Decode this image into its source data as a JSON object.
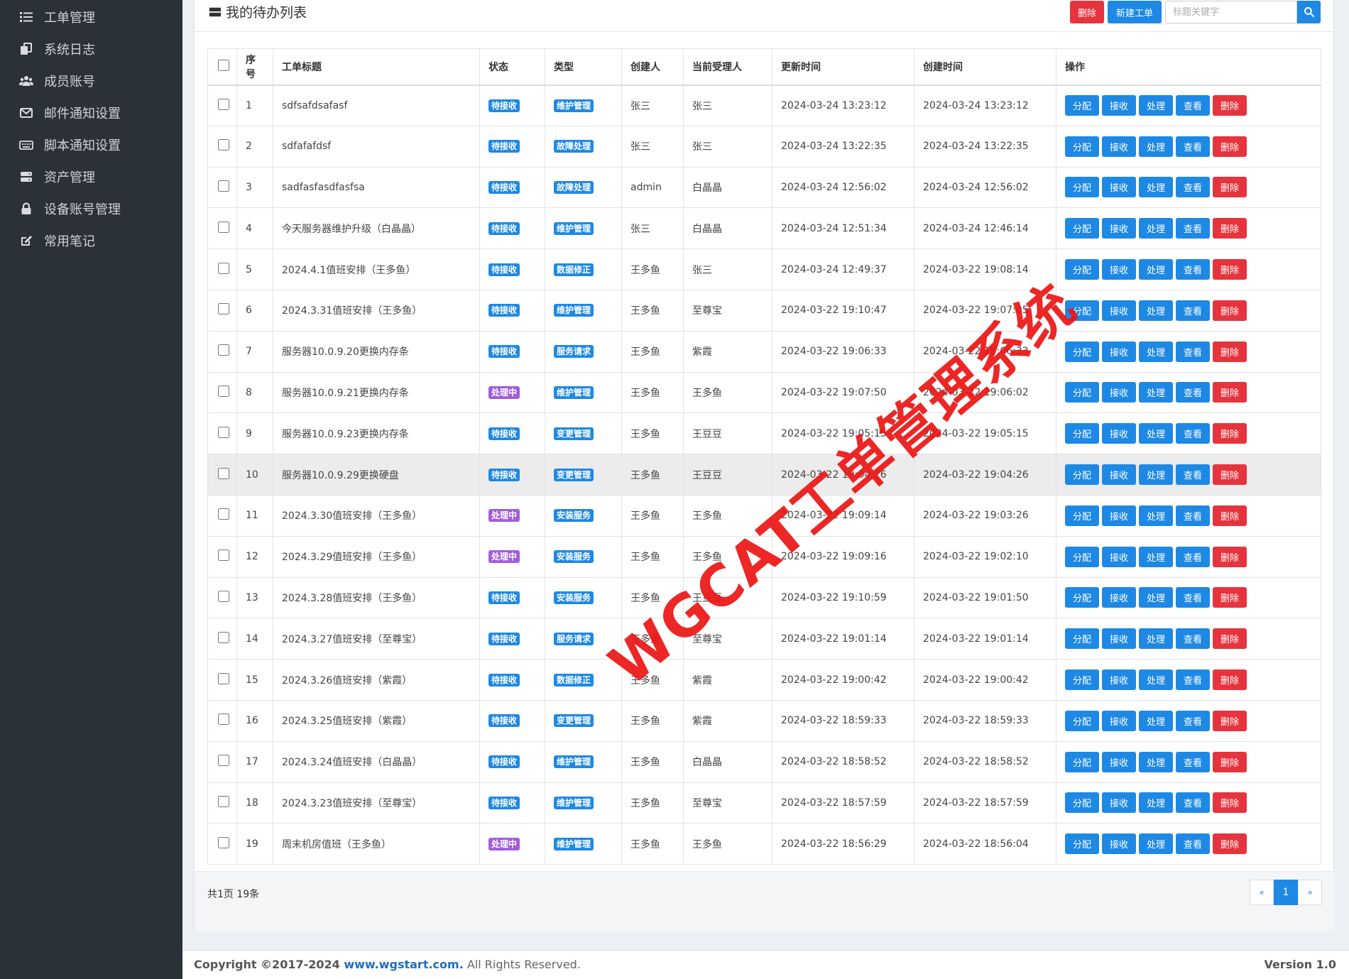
{
  "sidebar": {
    "items": [
      {
        "label": "工单管理",
        "icon": "list-icon"
      },
      {
        "label": "系统日志",
        "icon": "copy-icon"
      },
      {
        "label": "成员账号",
        "icon": "users-icon"
      },
      {
        "label": "邮件通知设置",
        "icon": "mail-icon"
      },
      {
        "label": "脚本通知设置",
        "icon": "keyboard-icon"
      },
      {
        "label": "资产管理",
        "icon": "server-icon"
      },
      {
        "label": "设备账号管理",
        "icon": "lock-icon"
      },
      {
        "label": "常用笔记",
        "icon": "edit-icon"
      }
    ]
  },
  "panel": {
    "title": "我的待办列表",
    "delete_label": "删除",
    "new_label": "新建工单",
    "search_placeholder": "标题关键字"
  },
  "table": {
    "headers": [
      "序号",
      "工单标题",
      "状态",
      "类型",
      "创建人",
      "当前受理人",
      "更新时间",
      "创建时间",
      "操作"
    ],
    "actions": [
      "分配",
      "接收",
      "处理",
      "查看",
      "删除"
    ],
    "rows": [
      {
        "no": "1",
        "title": "sdfsafdsafasf",
        "status": "待接收",
        "type": "维护管理",
        "creator": "张三",
        "assignee": "张三",
        "updated": "2024-03-24 13:23:12",
        "created": "2024-03-24 13:23:12"
      },
      {
        "no": "2",
        "title": "sdfafafdsf",
        "status": "待接收",
        "type": "故障处理",
        "creator": "张三",
        "assignee": "张三",
        "updated": "2024-03-24 13:22:35",
        "created": "2024-03-24 13:22:35"
      },
      {
        "no": "3",
        "title": "sadfasfasdfasfsa",
        "status": "待接收",
        "type": "故障处理",
        "creator": "admin",
        "assignee": "白晶晶",
        "updated": "2024-03-24 12:56:02",
        "created": "2024-03-24 12:56:02"
      },
      {
        "no": "4",
        "title": "今天服务器维护升级（白晶晶）",
        "status": "待接收",
        "type": "维护管理",
        "creator": "张三",
        "assignee": "白晶晶",
        "updated": "2024-03-24 12:51:34",
        "created": "2024-03-24 12:46:14"
      },
      {
        "no": "5",
        "title": "2024.4.1值班安排（王多鱼）",
        "status": "待接收",
        "type": "数据修正",
        "creator": "王多鱼",
        "assignee": "张三",
        "updated": "2024-03-24 12:49:37",
        "created": "2024-03-22 19:08:14"
      },
      {
        "no": "6",
        "title": "2024.3.31值班安排（王多鱼）",
        "status": "待接收",
        "type": "维护管理",
        "creator": "王多鱼",
        "assignee": "至尊宝",
        "updated": "2024-03-22 19:10:47",
        "created": "2024-03-22 19:07:05"
      },
      {
        "no": "7",
        "title": "服务器10.0.9.20更换内存条",
        "status": "待接收",
        "type": "服务请求",
        "creator": "王多鱼",
        "assignee": "紫霞",
        "updated": "2024-03-22 19:06:33",
        "created": "2024-03-22 19:06:33"
      },
      {
        "no": "8",
        "title": "服务器10.0.9.21更换内存条",
        "status": "处理中",
        "type": "维护管理",
        "creator": "王多鱼",
        "assignee": "王多鱼",
        "updated": "2024-03-22 19:07:50",
        "created": "2024-03-22 19:06:02"
      },
      {
        "no": "9",
        "title": "服务器10.0.9.23更换内存条",
        "status": "待接收",
        "type": "变更管理",
        "creator": "王多鱼",
        "assignee": "王豆豆",
        "updated": "2024-03-22 19:05:15",
        "created": "2024-03-22 19:05:15"
      },
      {
        "no": "10",
        "title": "服务器10.0.9.29更换硬盘",
        "status": "待接收",
        "type": "变更管理",
        "creator": "王多鱼",
        "assignee": "王豆豆",
        "updated": "2024-03-22 19:04:26",
        "created": "2024-03-22 19:04:26"
      },
      {
        "no": "11",
        "title": "2024.3.30值班安排（王多鱼）",
        "status": "处理中",
        "type": "安装服务",
        "creator": "王多鱼",
        "assignee": "王多鱼",
        "updated": "2024-03-22 19:09:14",
        "created": "2024-03-22 19:03:26"
      },
      {
        "no": "12",
        "title": "2024.3.29值班安排（王多鱼）",
        "status": "处理中",
        "type": "安装服务",
        "creator": "王多鱼",
        "assignee": "王多鱼",
        "updated": "2024-03-22 19:09:16",
        "created": "2024-03-22 19:02:10"
      },
      {
        "no": "13",
        "title": "2024.3.28值班安排（王多鱼）",
        "status": "待接收",
        "type": "安装服务",
        "creator": "王多鱼",
        "assignee": "王豆豆",
        "updated": "2024-03-22 19:10:59",
        "created": "2024-03-22 19:01:50"
      },
      {
        "no": "14",
        "title": "2024.3.27值班安排（至尊宝）",
        "status": "待接收",
        "type": "服务请求",
        "creator": "王多鱼",
        "assignee": "至尊宝",
        "updated": "2024-03-22 19:01:14",
        "created": "2024-03-22 19:01:14"
      },
      {
        "no": "15",
        "title": "2024.3.26值班安排（紫霞）",
        "status": "待接收",
        "type": "数据修正",
        "creator": "王多鱼",
        "assignee": "紫霞",
        "updated": "2024-03-22 19:00:42",
        "created": "2024-03-22 19:00:42"
      },
      {
        "no": "16",
        "title": "2024.3.25值班安排（紫霞）",
        "status": "待接收",
        "type": "变更管理",
        "creator": "王多鱼",
        "assignee": "紫霞",
        "updated": "2024-03-22 18:59:33",
        "created": "2024-03-22 18:59:33"
      },
      {
        "no": "17",
        "title": "2024.3.24值班安排（白晶晶）",
        "status": "待接收",
        "type": "维护管理",
        "creator": "王多鱼",
        "assignee": "白晶晶",
        "updated": "2024-03-22 18:58:52",
        "created": "2024-03-22 18:58:52"
      },
      {
        "no": "18",
        "title": "2024.3.23值班安排（至尊宝）",
        "status": "待接收",
        "type": "维护管理",
        "creator": "王多鱼",
        "assignee": "至尊宝",
        "updated": "2024-03-22 18:57:59",
        "created": "2024-03-22 18:57:59"
      },
      {
        "no": "19",
        "title": "周末机房值班（王多鱼）",
        "status": "处理中",
        "type": "维护管理",
        "creator": "王多鱼",
        "assignee": "王多鱼",
        "updated": "2024-03-22 18:56:29",
        "created": "2024-03-22 18:56:04"
      }
    ]
  },
  "pagination": {
    "summary": "共1页 19条",
    "prev": "«",
    "current": "1",
    "next": "»"
  },
  "footer": {
    "copyright_prefix": "Copyright ©2017-2024 ",
    "site": "www.wgstart.com.",
    "rights": " All Rights Reserved.",
    "version": "Version 1.0"
  },
  "watermark": "WGCAT工单管理系统",
  "colors": {
    "primary": "#1e88e5",
    "danger": "#e5343d",
    "processing": "#a25ddc",
    "sidebar": "#2b3139"
  }
}
